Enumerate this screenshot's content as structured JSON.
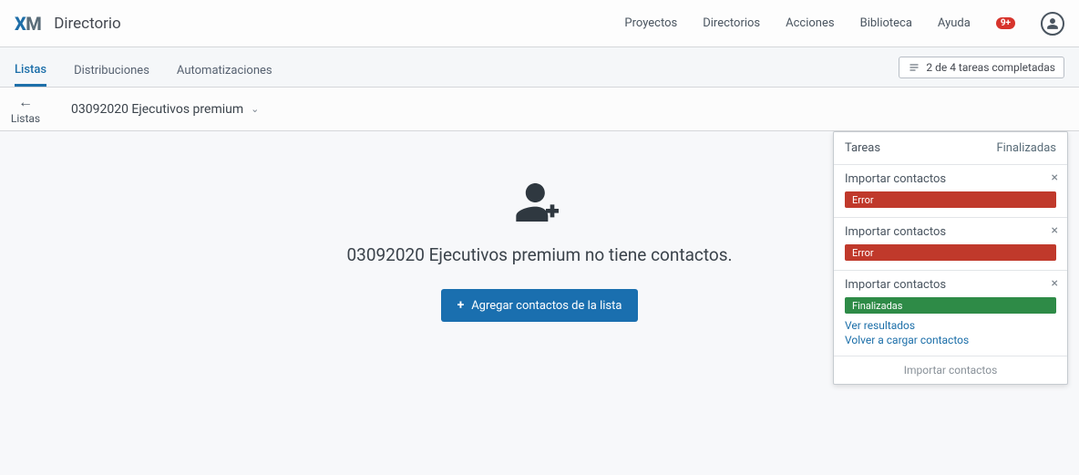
{
  "header": {
    "logo_x": "X",
    "logo_m": "M",
    "section": "Directorio",
    "nav": {
      "proyectos": "Proyectos",
      "directorios": "Directorios",
      "acciones": "Acciones",
      "biblioteca": "Biblioteca",
      "ayuda": "Ayuda"
    },
    "notif_count": "9+"
  },
  "subnav": {
    "tabs": {
      "listas": "Listas",
      "distribuciones": "Distribuciones",
      "automatizaciones": "Automatizaciones"
    },
    "tasks_summary": "2 de 4 tareas completadas"
  },
  "crumb": {
    "back_label": "Listas",
    "list_name": "03092020 Ejecutivos premium"
  },
  "empty": {
    "message": "03092020 Ejecutivos premium no tiene contactos.",
    "button": "Agregar contactos de la lista"
  },
  "tasks_panel": {
    "header_left": "Tareas",
    "header_right": "Finalizadas",
    "items": [
      {
        "title": "Importar contactos",
        "status": "Error",
        "kind": "error"
      },
      {
        "title": "Importar contactos",
        "status": "Error",
        "kind": "error"
      },
      {
        "title": "Importar contactos",
        "status": "Finalizadas",
        "kind": "ok",
        "links": {
          "results": "Ver resultados",
          "reload": "Volver a cargar contactos"
        }
      }
    ],
    "footer": "Importar contactos"
  }
}
